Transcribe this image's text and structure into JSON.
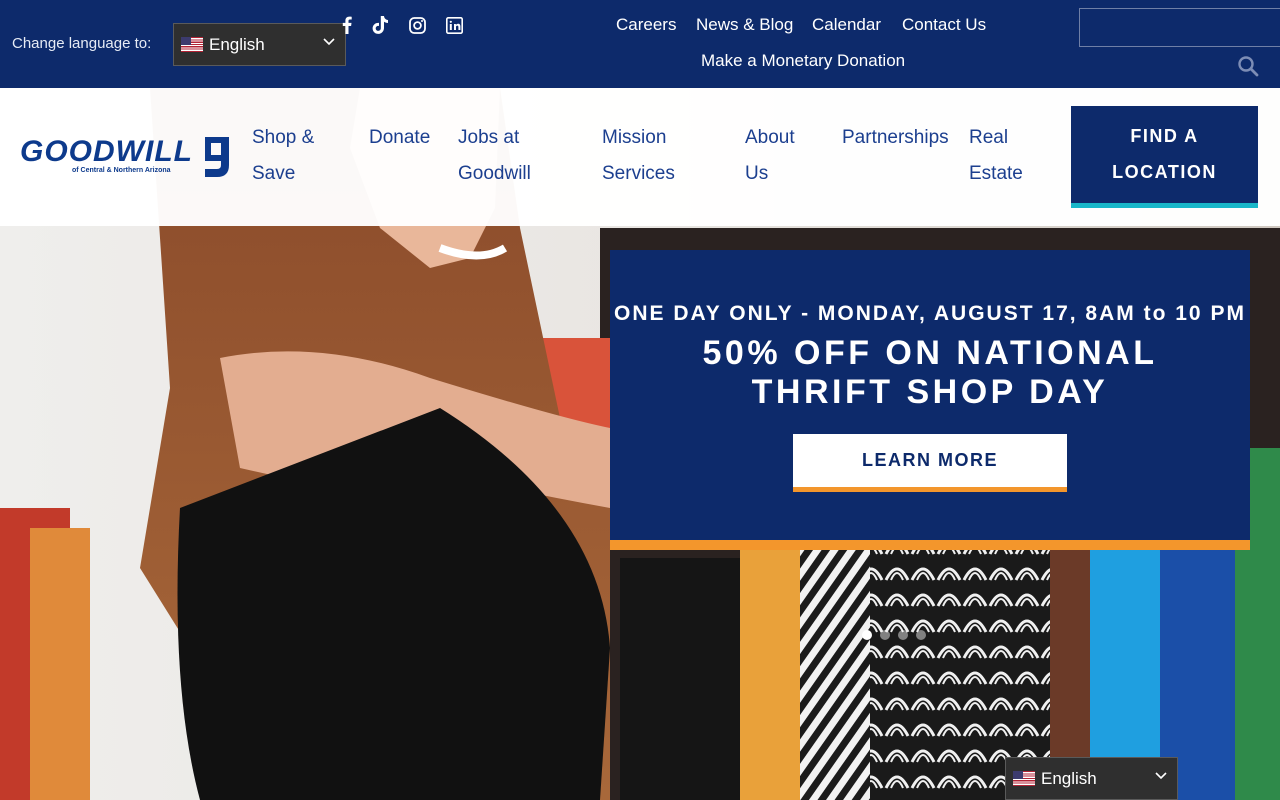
{
  "topbar": {
    "language_label": "Change language to:",
    "language_value": "English",
    "social": [
      "facebook-icon",
      "tiktok-icon",
      "instagram-icon",
      "linkedin-icon"
    ],
    "links": [
      "Careers",
      "News & Blog",
      "Calendar",
      "Contact Us"
    ],
    "donation_link": "Make a Monetary Donation",
    "search_placeholder": ""
  },
  "brand": {
    "name": "GOODWILL",
    "tagline": "of Central & Northern Arizona"
  },
  "nav": {
    "items": [
      {
        "line1": "Shop &",
        "line2": "Save"
      },
      {
        "line1": "Donate",
        "line2": ""
      },
      {
        "line1": "Jobs at",
        "line2": "Goodwill"
      },
      {
        "line1": "Mission",
        "line2": "Services"
      },
      {
        "line1": "About",
        "line2": "Us"
      },
      {
        "line1": "Partnerships",
        "line2": ""
      },
      {
        "line1": "Real",
        "line2": "Estate"
      }
    ],
    "cta": {
      "line1": "FIND A",
      "line2": "LOCATION"
    }
  },
  "promo": {
    "line1": "ONE DAY ONLY - MONDAY, AUGUST 17, 8AM to 10 PM",
    "headline": "50% OFF ON NATIONAL THRIFT SHOP DAY",
    "button": "LEARN MORE"
  },
  "slider": {
    "count": 4,
    "active": 1
  },
  "floating_language": {
    "value": "English"
  },
  "colors": {
    "navy": "#0d2a6b",
    "nav_text": "#1c3f8f",
    "accent_orange": "#f3962c",
    "accent_teal": "#18b7c9"
  }
}
